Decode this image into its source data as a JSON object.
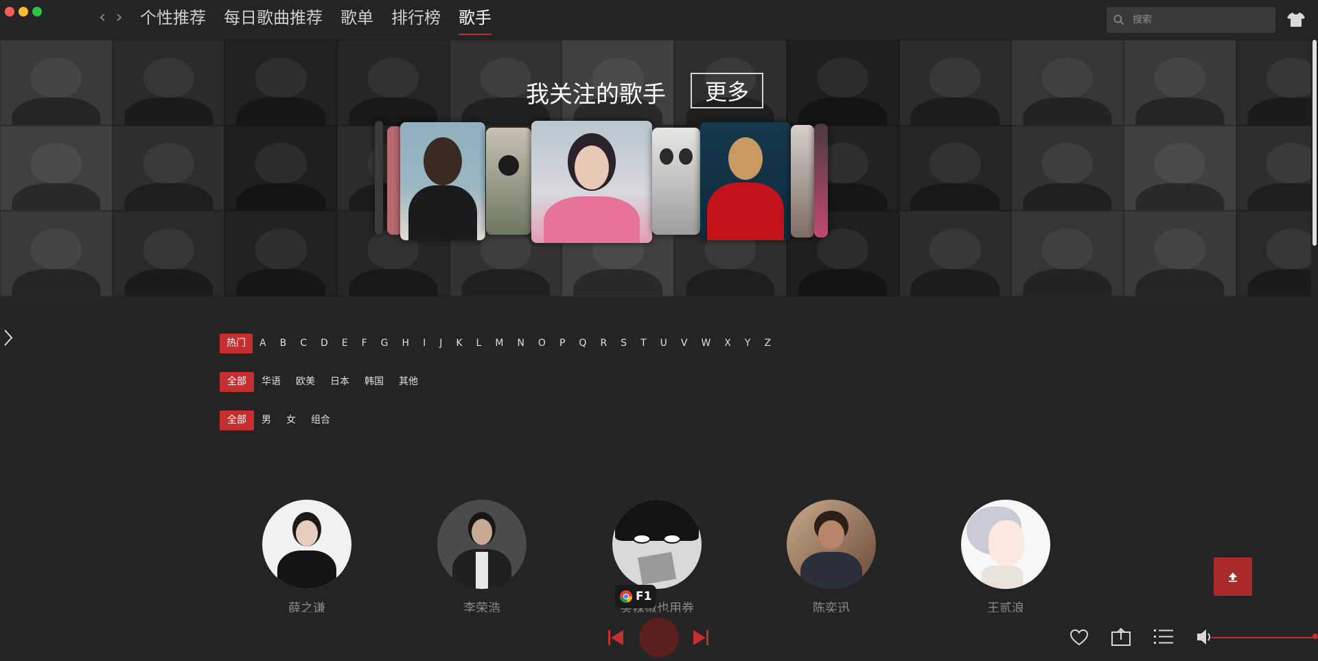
{
  "window": {
    "nav_tabs": [
      {
        "label": "个性推荐"
      },
      {
        "label": "每日歌曲推荐"
      },
      {
        "label": "歌单"
      },
      {
        "label": "排行榜"
      },
      {
        "label": "歌手"
      }
    ],
    "active_tab": "歌手",
    "search_placeholder": "搜索"
  },
  "banner": {
    "title": "我关注的歌手",
    "more_label": "更多"
  },
  "filters": {
    "letters": [
      "热门",
      "A",
      "B",
      "C",
      "D",
      "E",
      "F",
      "G",
      "H",
      "I",
      "J",
      "K",
      "L",
      "M",
      "N",
      "O",
      "P",
      "Q",
      "R",
      "S",
      "T",
      "U",
      "V",
      "W",
      "X",
      "Y",
      "Z"
    ],
    "regions": [
      "全部",
      "华语",
      "欧美",
      "日本",
      "韩国",
      "其他"
    ],
    "genders": [
      "全部",
      "男",
      "女",
      "组合"
    ],
    "active_letter": "热门",
    "active_region": "全部",
    "active_gender": "全部"
  },
  "artists": [
    {
      "name": "薛之谦"
    },
    {
      "name": "李荣浩"
    },
    {
      "name": "买辣椒也用券"
    },
    {
      "name": "陈奕迅"
    },
    {
      "name": "王贰浪"
    }
  ],
  "badge": {
    "label": "F1"
  },
  "colors": {
    "accent": "#c62f2f",
    "background": "#242424"
  }
}
